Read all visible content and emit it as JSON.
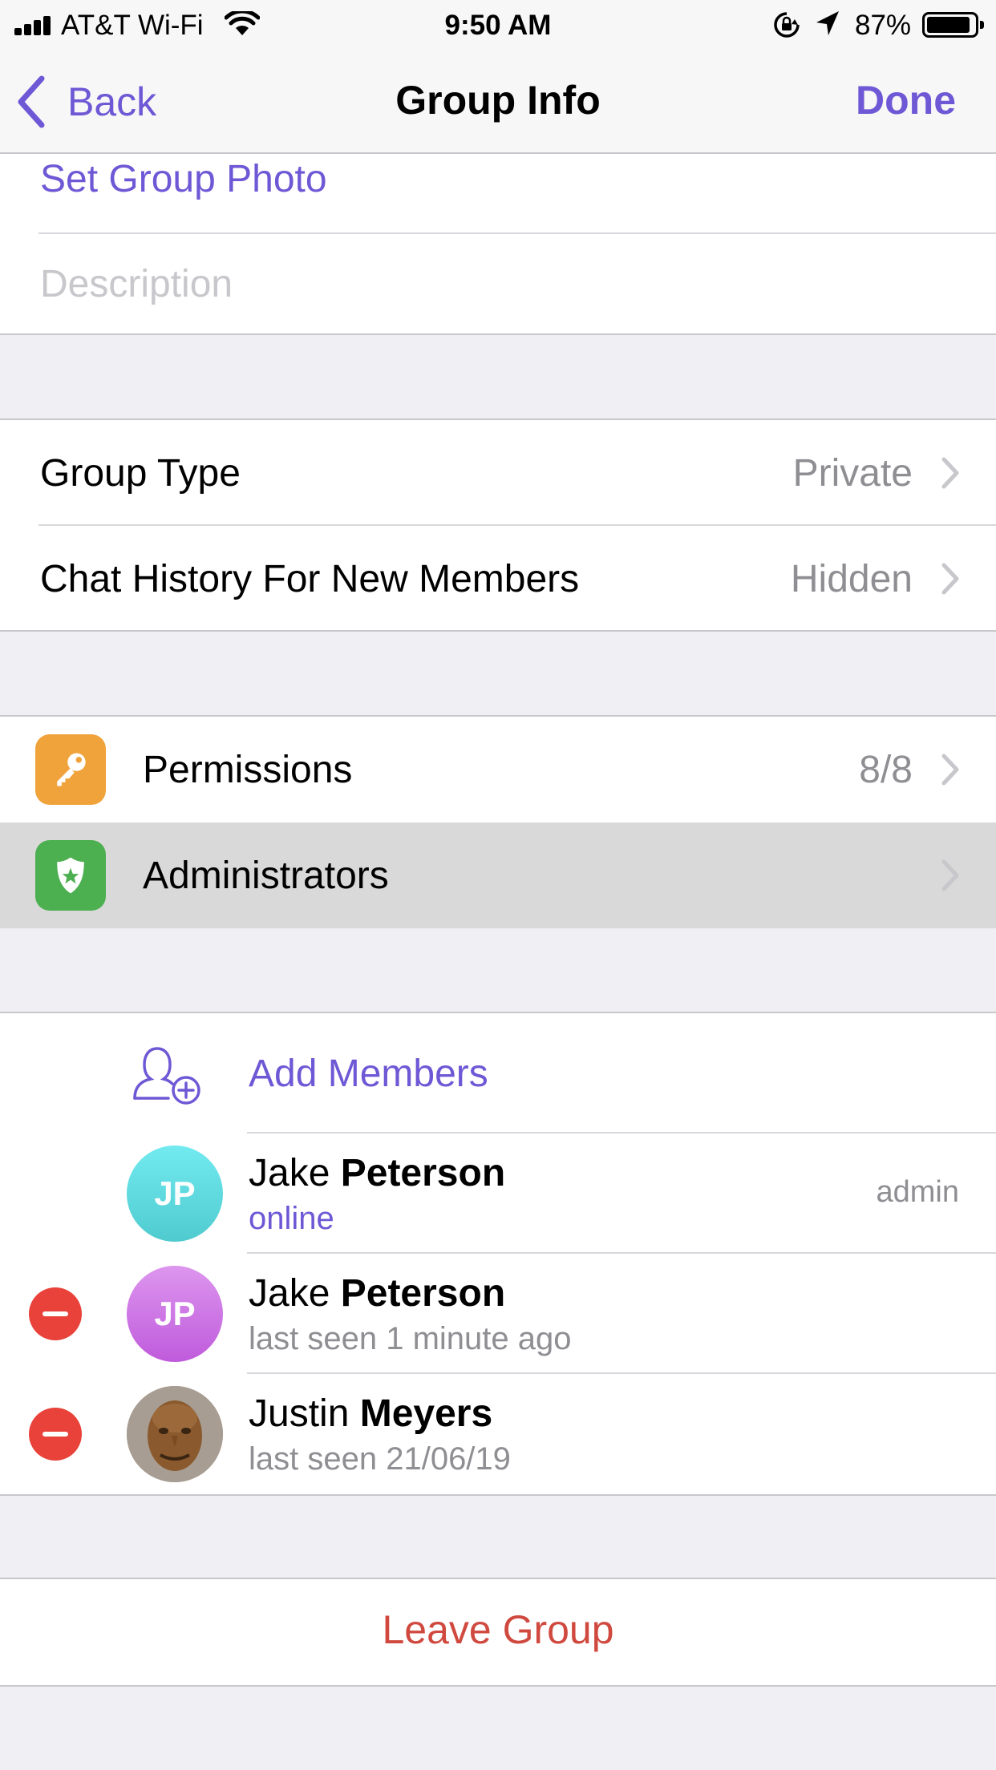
{
  "status_bar": {
    "carrier": "AT&T Wi-Fi",
    "time": "9:50 AM",
    "battery": "87%",
    "battery_level": 0.87
  },
  "nav": {
    "back_label": "Back",
    "title": "Group Info",
    "done_label": "Done"
  },
  "info_section": {
    "set_photo_label": "Set Group Photo",
    "description_placeholder": "Description"
  },
  "settings_section": {
    "group_type_label": "Group Type",
    "group_type_value": "Private",
    "history_label": "Chat History For New Members",
    "history_value": "Hidden"
  },
  "admin_section": {
    "permissions_label": "Permissions",
    "permissions_value": "8/8",
    "administrators_label": "Administrators"
  },
  "members_section": {
    "add_members_label": "Add Members",
    "members": [
      {
        "initials": "JP",
        "first": "Jake",
        "last": "Peterson",
        "status": "online",
        "role": "admin"
      },
      {
        "initials": "JP",
        "first": "Jake",
        "last": "Peterson",
        "status": "last seen 1 minute ago",
        "role": ""
      },
      {
        "initials": "",
        "first": "Justin",
        "last": "Meyers",
        "status": "last seen 21/06/19",
        "role": ""
      }
    ]
  },
  "leave_label": "Leave Group",
  "colors": {
    "accent": "#6f58d5",
    "destructive": "#d0493f",
    "permissions_icon": "#f0a23b",
    "administrators_icon": "#4caf50"
  },
  "icons": [
    "back-chevron-icon",
    "key-icon",
    "shield-star-icon",
    "add-member-icon",
    "remove-icon",
    "chevron-right-icon",
    "wifi-icon",
    "location-icon",
    "rotation-lock-icon"
  ]
}
